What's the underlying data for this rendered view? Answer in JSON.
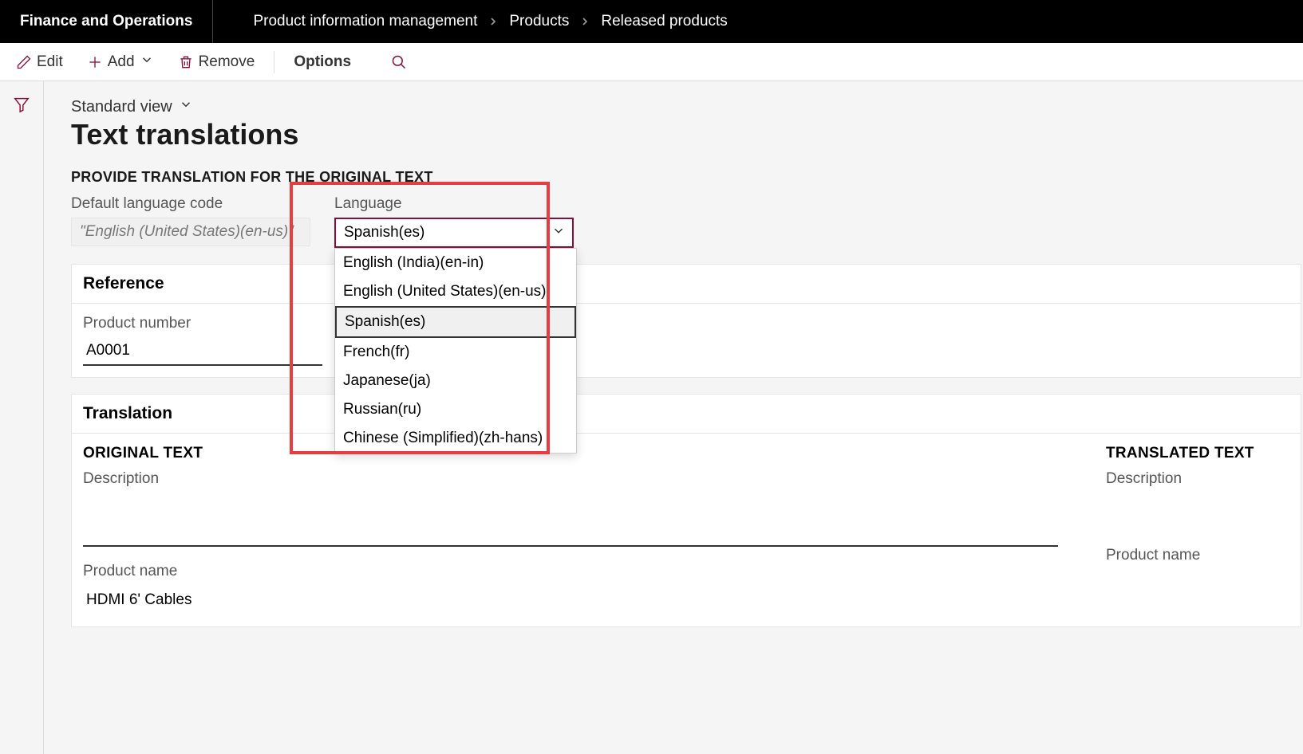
{
  "header": {
    "app_title": "Finance and Operations",
    "breadcrumb": [
      "Product information management",
      "Products",
      "Released products"
    ]
  },
  "actions": {
    "edit": "Edit",
    "add": "Add",
    "remove": "Remove",
    "options": "Options"
  },
  "view": {
    "selector": "Standard view"
  },
  "page": {
    "title": "Text translations",
    "section": "PROVIDE TRANSLATION FOR THE ORIGINAL TEXT"
  },
  "form": {
    "default_lang_label": "Default language code",
    "default_lang_value": "\"English (United States)(en-us)\"",
    "language_label": "Language",
    "language_value": "Spanish(es)",
    "language_options": [
      "English (India)(en-in)",
      "English (United States)(en-us)",
      "Spanish(es)",
      "French(fr)",
      "Japanese(ja)",
      "Russian(ru)",
      "Chinese (Simplified)(zh-hans)"
    ]
  },
  "reference": {
    "header": "Reference",
    "product_number_label": "Product number",
    "product_number_value": "A0001"
  },
  "translation": {
    "header": "Translation",
    "original_title": "ORIGINAL TEXT",
    "translated_title": "TRANSLATED TEXT",
    "description_label": "Description",
    "product_name_label": "Product name",
    "product_name_value": "HDMI 6' Cables"
  }
}
